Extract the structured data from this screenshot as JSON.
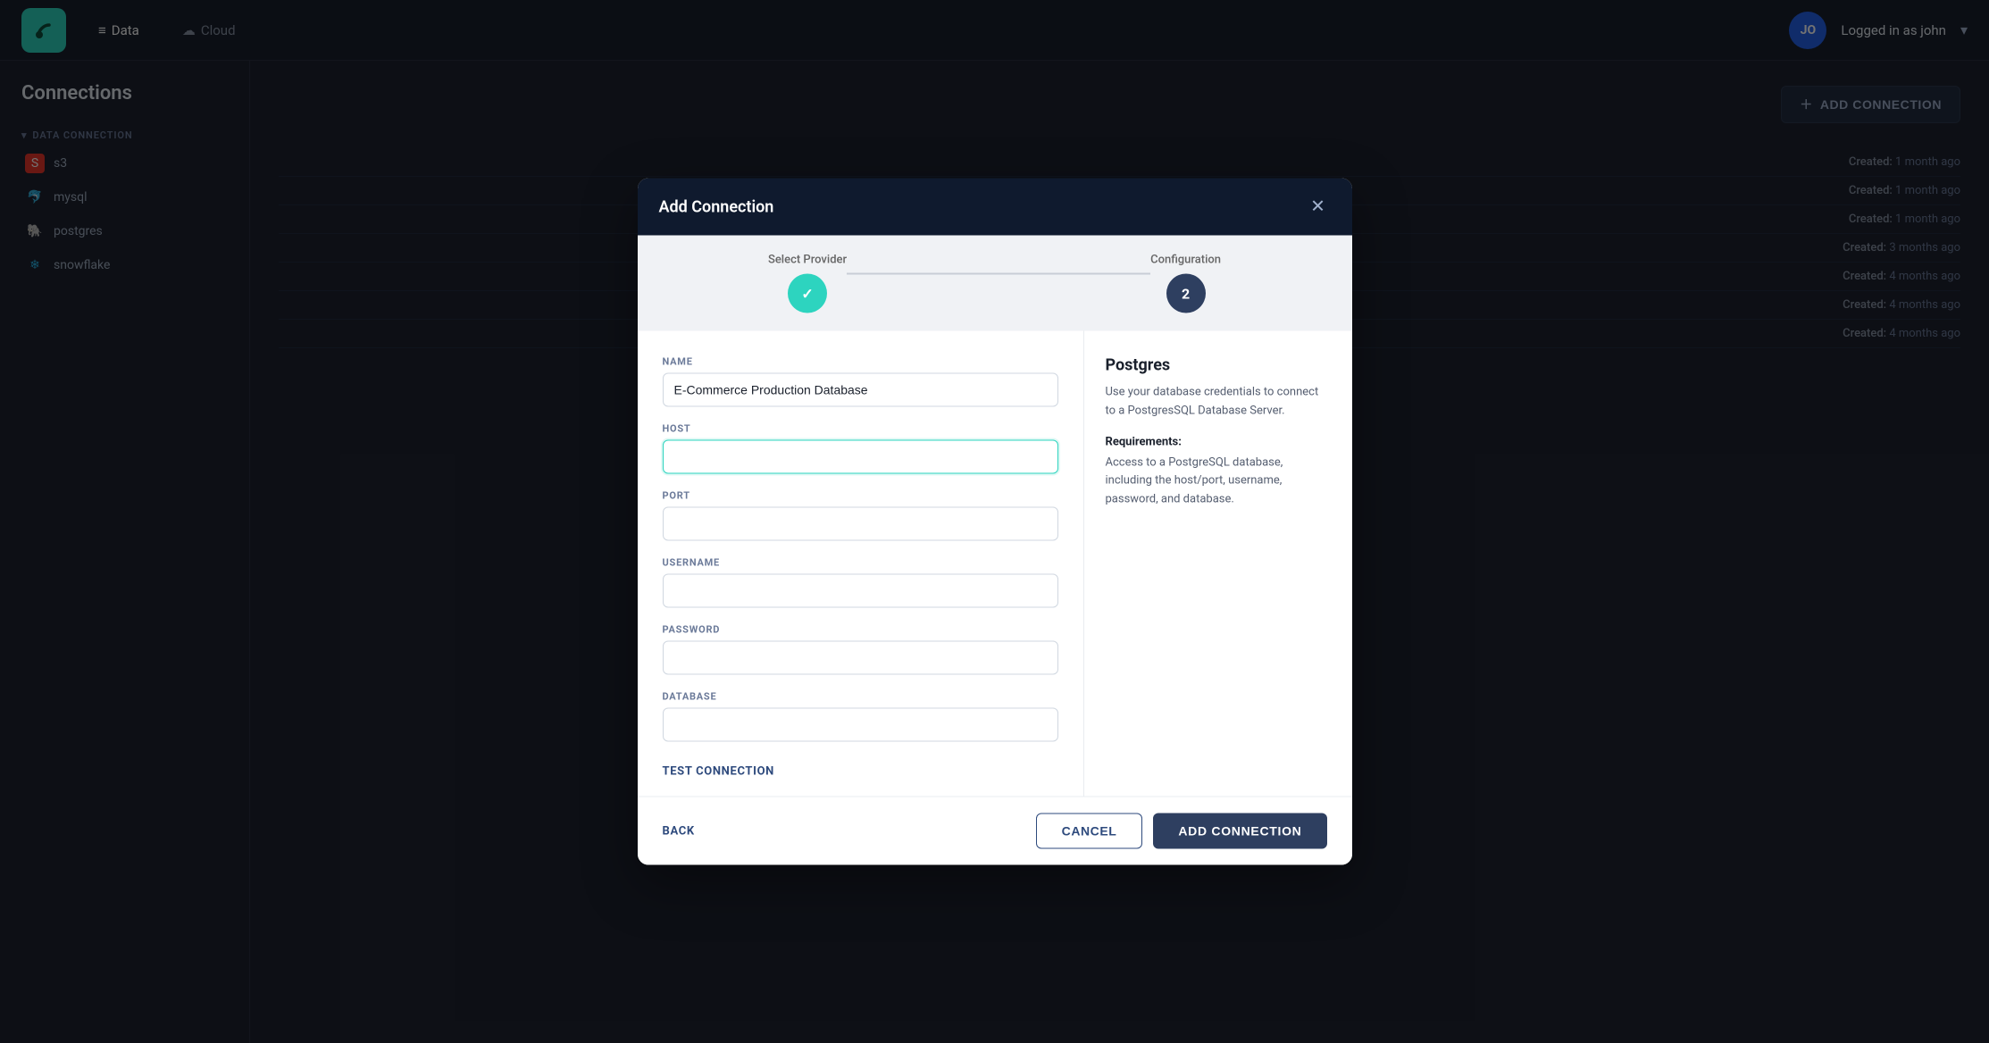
{
  "app": {
    "logo_text": "p",
    "nav": [
      {
        "label": "Data",
        "icon": "📊",
        "active": true
      },
      {
        "label": "Cloud",
        "icon": "☁️",
        "active": false
      }
    ],
    "user": {
      "initials": "JO",
      "label": "Logged in as john",
      "chevron": "▾"
    }
  },
  "sidebar": {
    "title": "Connections",
    "section_label": "DATA CONNECTION",
    "items": [
      {
        "label": "s3",
        "icon_type": "s3"
      },
      {
        "label": "mysql",
        "icon_type": "mysql"
      },
      {
        "label": "postgres",
        "icon_type": "postgres"
      },
      {
        "label": "snowflake",
        "icon_type": "snowflake"
      }
    ]
  },
  "add_connection_btn": {
    "label": "ADD CONNECTION",
    "icon": "+"
  },
  "bg_rows": [
    {
      "created": "Created:",
      "time": "1 month ago"
    },
    {
      "created": "Created:",
      "time": "1 month ago"
    },
    {
      "created": "Created:",
      "time": "1 month ago"
    },
    {
      "created": "Created:",
      "time": "3 months ago"
    },
    {
      "created": "Created:",
      "time": "4 months ago"
    },
    {
      "created": "Created:",
      "time": "4 months ago"
    },
    {
      "created": "Created:",
      "time": "4 months ago"
    }
  ],
  "modal": {
    "title": "Add Connection",
    "close_icon": "✕",
    "stepper": {
      "step1": {
        "label": "Select Provider",
        "state": "done",
        "icon": "✓"
      },
      "step2": {
        "label": "Configuration",
        "state": "active",
        "number": "2"
      }
    },
    "form": {
      "name_label": "NAME",
      "name_value": "E-Commerce Production Database",
      "name_placeholder": "",
      "host_label": "HOST",
      "host_value": "",
      "host_placeholder": "",
      "port_label": "PORT",
      "port_value": "",
      "port_placeholder": "",
      "username_label": "USERNAME",
      "username_value": "",
      "username_placeholder": "",
      "password_label": "PASSWORD",
      "password_value": "",
      "password_placeholder": "",
      "database_label": "DATABASE",
      "database_value": "",
      "database_placeholder": "",
      "test_connection_label": "TEST CONNECTION"
    },
    "info": {
      "title": "Postgres",
      "description": "Use your database credentials to connect to a PostgresSQL Database Server.",
      "requirements_title": "Requirements:",
      "requirements_text": "Access to a PostgreSQL database, including the host/port, username, password, and database."
    },
    "footer": {
      "back_label": "BACK",
      "cancel_label": "CANCEL",
      "add_label": "ADD CONNECTION"
    }
  }
}
